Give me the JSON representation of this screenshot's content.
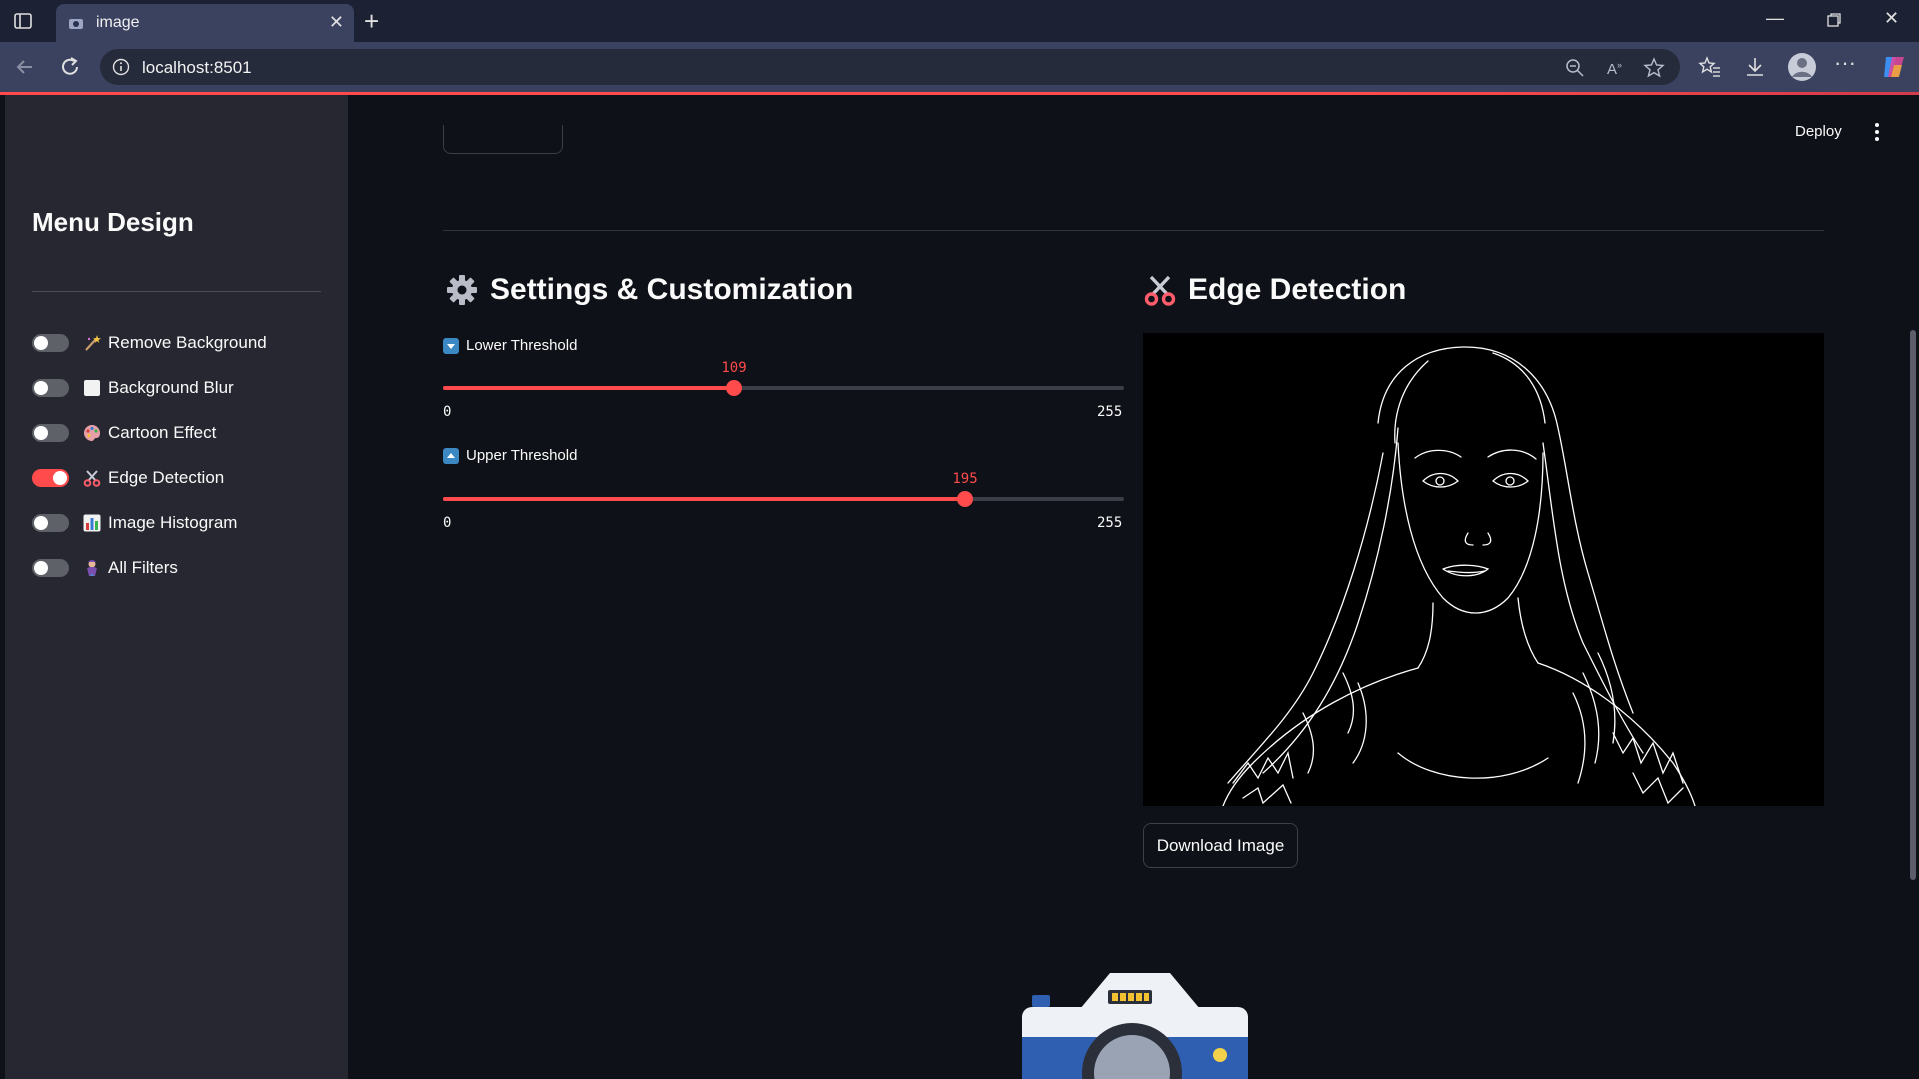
{
  "browser": {
    "tab_title": "image",
    "url": "localhost:8501"
  },
  "header": {
    "deploy_label": "Deploy"
  },
  "sidebar": {
    "title": "Menu Design",
    "toggles": [
      {
        "label": "Remove Background",
        "icon": "magic-wand-icon",
        "on": false
      },
      {
        "label": "Background Blur",
        "icon": "white-square-icon",
        "on": false
      },
      {
        "label": "Cartoon Effect",
        "icon": "palette-icon",
        "on": false
      },
      {
        "label": "Edge Detection",
        "icon": "scissors-icon",
        "on": true
      },
      {
        "label": "Image Histogram",
        "icon": "bar-chart-icon",
        "on": false
      },
      {
        "label": "All Filters",
        "icon": "genie-icon",
        "on": false
      }
    ]
  },
  "settings": {
    "title": "Settings & Customization",
    "icon": "gear-icon",
    "sliders": [
      {
        "label": "Lower Threshold",
        "icon": "down-arrow-button-icon",
        "value": 109,
        "value_text": "109",
        "min": 0,
        "max": 255,
        "min_text": "0",
        "max_text": "255"
      },
      {
        "label": "Upper Threshold",
        "icon": "up-arrow-button-icon",
        "value": 195,
        "value_text": "195",
        "min": 0,
        "max": 255,
        "min_text": "0",
        "max_text": "255"
      }
    ]
  },
  "edge_panel": {
    "title": "Edge Detection",
    "icon": "scissors-icon",
    "image_description_icon": "edge-detected-portrait-image",
    "download_label": "Download Image"
  },
  "colors": {
    "accent": "#ff4b4b",
    "sidebar_bg": "#262730",
    "main_bg": "#0e1117"
  }
}
